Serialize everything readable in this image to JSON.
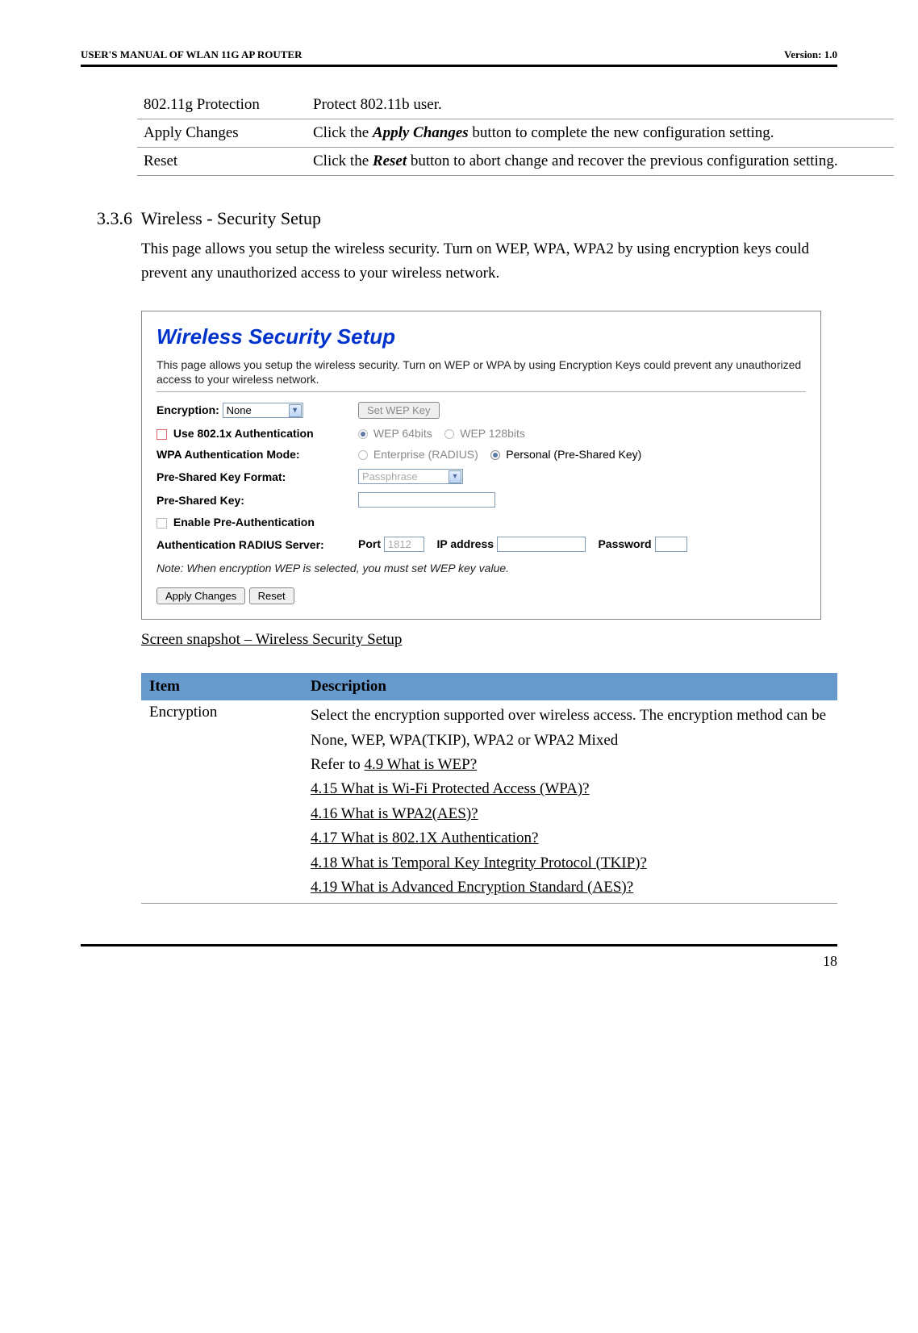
{
  "header": {
    "left": "USER'S MANUAL OF WLAN 11G AP ROUTER",
    "right": "Version: 1.0"
  },
  "topTable": [
    {
      "item": "802.11g Protection",
      "desc_pre": "Protect 802.11b user.",
      "bi": "",
      "desc_post": ""
    },
    {
      "item": "Apply Changes",
      "desc_pre": "Click the ",
      "bi": "Apply Changes",
      "desc_post": " button to complete the new configuration setting."
    },
    {
      "item": "Reset",
      "desc_pre": "Click the ",
      "bi": "Reset",
      "desc_post": " button to abort change and recover the previous configuration setting."
    }
  ],
  "section": {
    "num": "3.3.6",
    "title": "Wireless - Security Setup",
    "body": "This page allows you setup the wireless security. Turn on WEP, WPA, WPA2 by using encryption keys could prevent any unauthorized access to your wireless network."
  },
  "screenshot": {
    "title": "Wireless Security Setup",
    "desc": "This page allows you setup the wireless security. Turn on WEP or WPA by using Encryption Keys could prevent any unauthorized access to your wireless network.",
    "encryption_label": "Encryption:",
    "encryption_value": "None",
    "setwep_btn": "Set WEP Key",
    "use8021x_label": "Use 802.1x Authentication",
    "wep64": "WEP 64bits",
    "wep128": "WEP 128bits",
    "wpa_mode_label": "WPA Authentication Mode:",
    "wpa_enterprise": "Enterprise (RADIUS)",
    "wpa_personal": "Personal (Pre-Shared Key)",
    "psk_format_label": "Pre-Shared Key Format:",
    "psk_format_value": "Passphrase",
    "psk_label": "Pre-Shared Key:",
    "preauth_label": "Enable Pre-Authentication",
    "radius_label": "Authentication RADIUS Server:",
    "port_label": "Port",
    "port_value": "1812",
    "ip_label": "IP address",
    "password_label": "Password",
    "note": "Note: When encryption WEP is selected, you must set WEP key value.",
    "apply_btn": "Apply Changes",
    "reset_btn": "Reset"
  },
  "caption": "Screen snapshot – Wireless Security Setup",
  "descTable": {
    "header_item": "Item",
    "header_desc": "Description",
    "row_item": "Encryption",
    "row_intro": "Select the encryption supported over wireless access. The encryption method can be None, WEP, WPA(TKIP), WPA2 or WPA2 Mixed",
    "refer": "Refer to ",
    "links": [
      "4.9 What is WEP?",
      "4.15 What is Wi-Fi Protected Access (WPA)?",
      "4.16 What is WPA2(AES)?",
      "4.17 What is 802.1X Authentication?",
      "4.18 What is Temporal Key Integrity Protocol (TKIP)?",
      "4.19 What is Advanced Encryption Standard (AES)?"
    ]
  },
  "pageNum": "18"
}
